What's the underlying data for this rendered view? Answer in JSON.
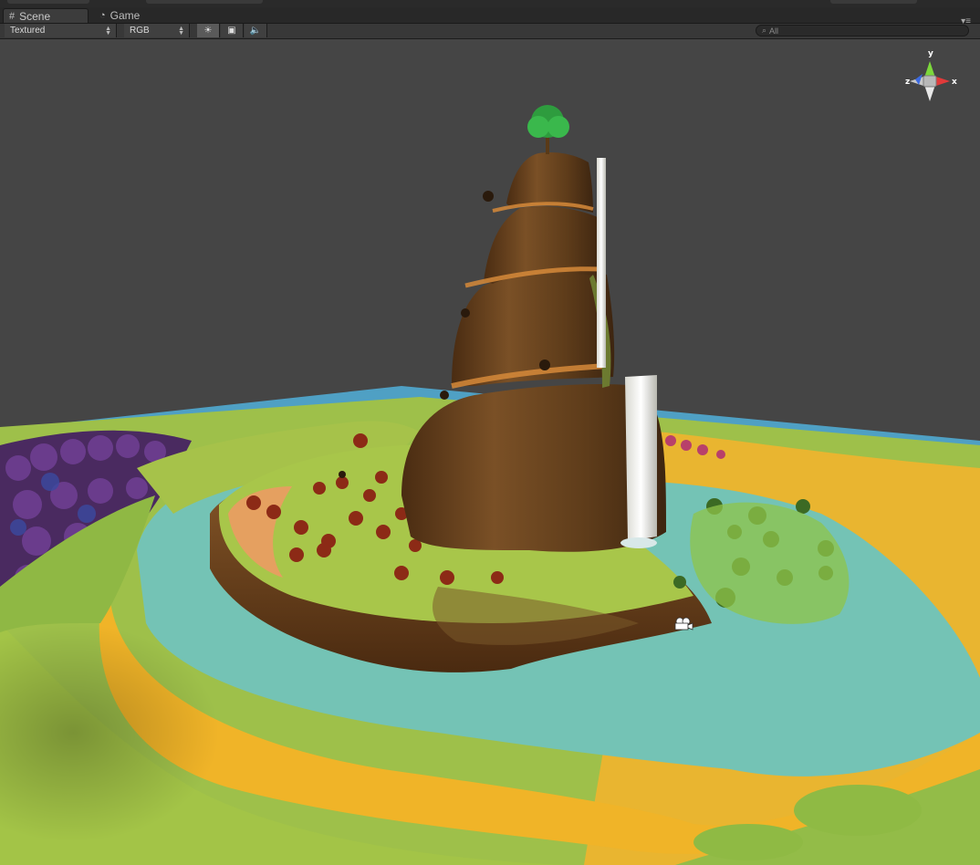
{
  "tabs": [
    {
      "label": "Scene",
      "icon": "grid-icon",
      "active": true
    },
    {
      "label": "Game",
      "icon": "pacman-icon",
      "active": false
    }
  ],
  "toolbar": {
    "render_mode": "Textured",
    "color_mode": "RGB",
    "lighting_icon": "sun-icon",
    "image_icon": "image-icon",
    "audio_icon": "speaker-icon",
    "search_placeholder": "All"
  },
  "gizmo": {
    "y_label": "y",
    "x_label": "x",
    "z_label": "z",
    "colors": {
      "x": "#e23a3a",
      "y": "#7cd83c",
      "z": "#3c6ae0"
    }
  },
  "scene": {
    "sky_color": "#454545",
    "water_color": "#5fa9c2",
    "grass_color": "#9bc24a",
    "sand_color": "#f0b22a",
    "rock_color": "#6a4320"
  }
}
